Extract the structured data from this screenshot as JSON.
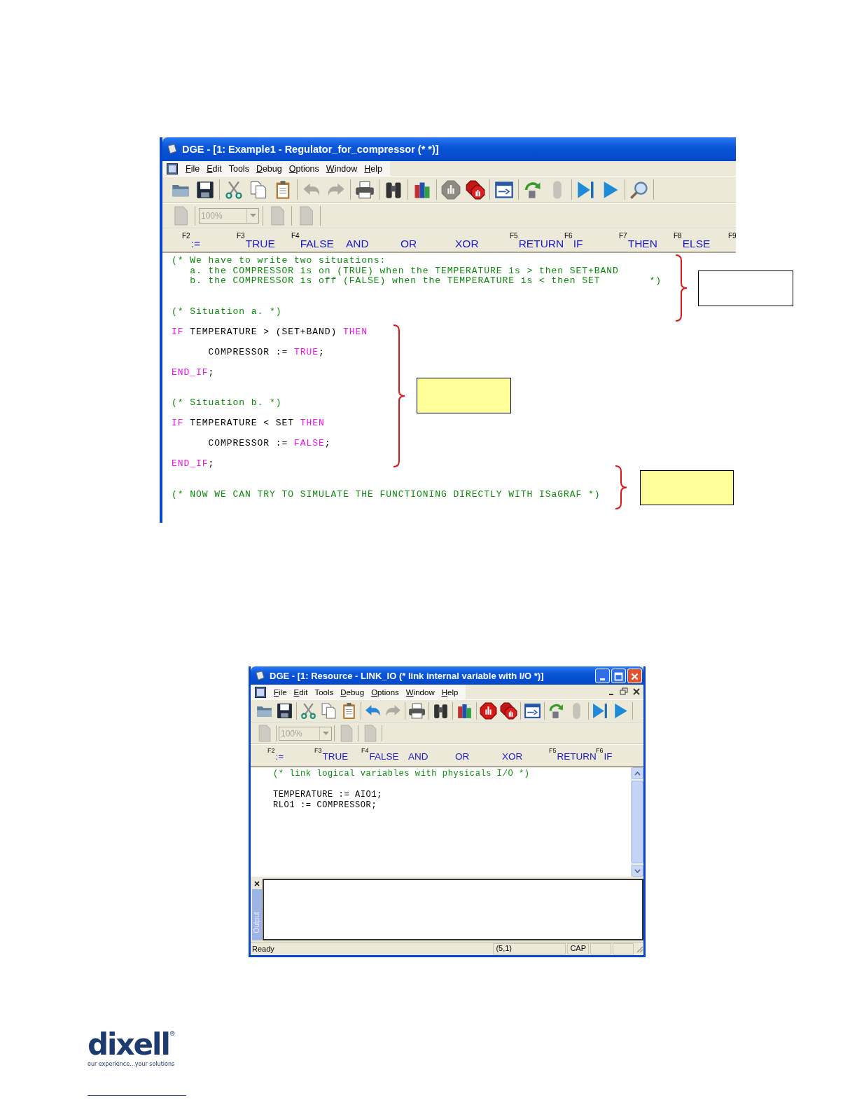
{
  "editor_window": {
    "title": "DGE - [1: Example1 - Regulator_for_compressor (*  *)]",
    "menu": [
      {
        "label": "File",
        "mnemonic": true
      },
      {
        "label": "Edit",
        "mnemonic": true
      },
      {
        "label": "Tools",
        "mnemonic": false
      },
      {
        "label": "Debug",
        "mnemonic": true
      },
      {
        "label": "Options",
        "mnemonic": true
      },
      {
        "label": "Window",
        "mnemonic": true
      },
      {
        "label": "Help",
        "mnemonic": true
      }
    ],
    "toolbar": [
      {
        "buttons": [
          {
            "kind": "folder",
            "disabled": false
          },
          {
            "kind": "floppy",
            "disabled": false
          }
        ]
      },
      {
        "buttons": [
          {
            "kind": "scissors",
            "disabled": false
          },
          {
            "kind": "copy",
            "disabled": false
          },
          {
            "kind": "clipboard",
            "disabled": false
          }
        ]
      },
      {
        "buttons": [
          {
            "kind": "undo",
            "disabled": true
          },
          {
            "kind": "redo",
            "disabled": true
          }
        ]
      },
      {
        "buttons": [
          {
            "kind": "printer",
            "disabled": false
          }
        ]
      },
      {
        "buttons": [
          {
            "kind": "binoculars",
            "disabled": false
          }
        ]
      },
      {
        "buttons": [
          {
            "kind": "books",
            "disabled": false
          }
        ]
      },
      {
        "buttons": [
          {
            "kind": "stop",
            "disabled": true
          },
          {
            "kind": "stops",
            "disabled": false
          }
        ]
      },
      {
        "buttons": [
          {
            "kind": "window",
            "disabled": false
          }
        ]
      },
      {
        "buttons": [
          {
            "kind": "refresh",
            "disabled": false
          },
          {
            "kind": "capsule",
            "disabled": true
          }
        ]
      },
      {
        "buttons": [
          {
            "kind": "step",
            "disabled": false
          },
          {
            "kind": "play",
            "disabled": false
          }
        ]
      },
      {
        "buttons": [
          {
            "kind": "magnifier",
            "disabled": false
          }
        ]
      }
    ],
    "zoom_field": {
      "value": "100%",
      "disabled": true
    },
    "keywords": [
      {
        "key": "F2",
        "label": ":="
      },
      {
        "key": "F3",
        "label": "TRUE"
      },
      {
        "key": "F4",
        "label": "FALSE"
      },
      {
        "label": "AND"
      },
      {
        "label": "OR"
      },
      {
        "label": "XOR"
      },
      {
        "key": "F5",
        "label": "RETURN"
      },
      {
        "key": "F6",
        "label": "IF"
      },
      {
        "key": "F7",
        "label": "THEN"
      },
      {
        "key": "F8",
        "label": "ELSE"
      },
      {
        "key": "F9"
      }
    ],
    "code": [
      {
        "kind": "code",
        "tokens": [
          {
            "kind": "comment",
            "text": "(* We have to write two situations:"
          }
        ]
      },
      {
        "kind": "code",
        "tokens": [
          {
            "kind": "comment",
            "text": "   a. the COMPRESSOR is on (TRUE) when the TEMPERATURE is > then SET+BAND"
          }
        ]
      },
      {
        "kind": "code",
        "tokens": [
          {
            "kind": "comment",
            "text": "   b. the COMPRESSOR is off (FALSE) when the TEMPERATURE is < then SET        *)"
          }
        ]
      },
      {
        "kind": "blank"
      },
      {
        "kind": "blank"
      },
      {
        "kind": "code",
        "tokens": [
          {
            "kind": "comment",
            "text": "(* Situation a. *)"
          }
        ]
      },
      {
        "kind": "blank"
      },
      {
        "kind": "code",
        "tokens": [
          {
            "kind": "keyword",
            "text": "IF"
          },
          {
            "kind": "plain",
            "text": " TEMPERATURE > (SET+BAND) "
          },
          {
            "kind": "keyword",
            "text": "THEN"
          }
        ]
      },
      {
        "kind": "blank"
      },
      {
        "kind": "code",
        "tokens": [
          {
            "kind": "plain",
            "text": "      COMPRESSOR := "
          },
          {
            "kind": "keyword",
            "text": "TRUE"
          },
          {
            "kind": "plain",
            "text": ";"
          }
        ]
      },
      {
        "kind": "blank"
      },
      {
        "kind": "code",
        "tokens": [
          {
            "kind": "keyword",
            "text": "END_IF"
          },
          {
            "kind": "plain",
            "text": ";"
          }
        ]
      },
      {
        "kind": "blank"
      },
      {
        "kind": "blank"
      },
      {
        "kind": "code",
        "tokens": [
          {
            "kind": "comment",
            "text": "(* Situation b. *)"
          }
        ]
      },
      {
        "kind": "blank"
      },
      {
        "kind": "code",
        "tokens": [
          {
            "kind": "keyword",
            "text": "IF"
          },
          {
            "kind": "plain",
            "text": " TEMPERATURE < SET "
          },
          {
            "kind": "keyword",
            "text": "THEN"
          }
        ]
      },
      {
        "kind": "blank"
      },
      {
        "kind": "code",
        "tokens": [
          {
            "kind": "plain",
            "text": "      COMPRESSOR := "
          },
          {
            "kind": "keyword",
            "text": "FALSE"
          },
          {
            "kind": "plain",
            "text": ";"
          }
        ]
      },
      {
        "kind": "blank"
      },
      {
        "kind": "code",
        "tokens": [
          {
            "kind": "keyword",
            "text": "END_IF"
          },
          {
            "kind": "plain",
            "text": ";"
          }
        ]
      },
      {
        "kind": "blank"
      },
      {
        "kind": "blank"
      },
      {
        "kind": "code",
        "tokens": [
          {
            "kind": "comment",
            "text": "(* NOW WE CAN TRY TO SIMULATE THE FUNCTIONING DIRECTLY WITH ISaGRAF *)"
          }
        ]
      }
    ]
  },
  "callouts": [
    {
      "color": "#ffffff"
    },
    {
      "color": "#ffff99"
    },
    {
      "color": "#ffff99"
    }
  ],
  "resource_window": {
    "title": "DGE - [1: Resource - LINK_IO (* link internal variable with I/O *)]",
    "menu": [
      {
        "label": "File",
        "mnemonic": true
      },
      {
        "label": "Edit",
        "mnemonic": true
      },
      {
        "label": "Tools",
        "mnemonic": false
      },
      {
        "label": "Debug",
        "mnemonic": true
      },
      {
        "label": "Options",
        "mnemonic": true
      },
      {
        "label": "Window",
        "mnemonic": true
      },
      {
        "label": "Help",
        "mnemonic": true
      }
    ],
    "toolbar": [
      {
        "buttons": [
          {
            "kind": "folder",
            "disabled": false
          },
          {
            "kind": "floppy",
            "disabled": false
          }
        ]
      },
      {
        "buttons": [
          {
            "kind": "scissors",
            "disabled": false
          },
          {
            "kind": "copy",
            "disabled": false
          },
          {
            "kind": "clipboard",
            "disabled": false
          }
        ]
      },
      {
        "buttons": [
          {
            "kind": "undo",
            "disabled": false
          },
          {
            "kind": "redo",
            "disabled": true
          }
        ]
      },
      {
        "buttons": [
          {
            "kind": "printer",
            "disabled": false
          }
        ]
      },
      {
        "buttons": [
          {
            "kind": "binoculars",
            "disabled": false
          }
        ]
      },
      {
        "buttons": [
          {
            "kind": "books",
            "disabled": false
          }
        ]
      },
      {
        "buttons": [
          {
            "kind": "stop",
            "disabled": false
          },
          {
            "kind": "stops",
            "disabled": false
          }
        ]
      },
      {
        "buttons": [
          {
            "kind": "window",
            "disabled": false
          }
        ]
      },
      {
        "buttons": [
          {
            "kind": "refresh",
            "disabled": false
          },
          {
            "kind": "capsule",
            "disabled": true
          }
        ]
      },
      {
        "buttons": [
          {
            "kind": "step",
            "disabled": false
          },
          {
            "kind": "play",
            "disabled": false
          }
        ]
      }
    ],
    "zoom_field": {
      "value": "100%",
      "disabled": true
    },
    "keywords": [
      {
        "key": "F2",
        "label": ":="
      },
      {
        "key": "F3",
        "label": "TRUE"
      },
      {
        "key": "F4",
        "label": "FALSE"
      },
      {
        "label": "AND"
      },
      {
        "label": "OR"
      },
      {
        "label": "XOR"
      },
      {
        "key": "F5",
        "label": "RETURN"
      },
      {
        "key": "F6",
        "label": "IF"
      }
    ],
    "code": [
      {
        "kind": "code",
        "tokens": [
          {
            "kind": "comment",
            "text": "(* link logical variables with physicals I/O *)"
          }
        ]
      },
      {
        "kind": "blank"
      },
      {
        "kind": "code",
        "tokens": [
          {
            "kind": "plain",
            "text": "TEMPERATURE := AIO1;"
          }
        ]
      },
      {
        "kind": "code",
        "tokens": [
          {
            "kind": "plain",
            "text": "RLO1 := COMPRESSOR;"
          }
        ]
      }
    ],
    "output_tab": "Output",
    "status_bar": {
      "message": "Ready",
      "position": "(5,1)",
      "caps": "CAP"
    }
  },
  "logo": {
    "wordmark": "dixell",
    "registered": "®",
    "tagline": "our experience...your solutions"
  }
}
